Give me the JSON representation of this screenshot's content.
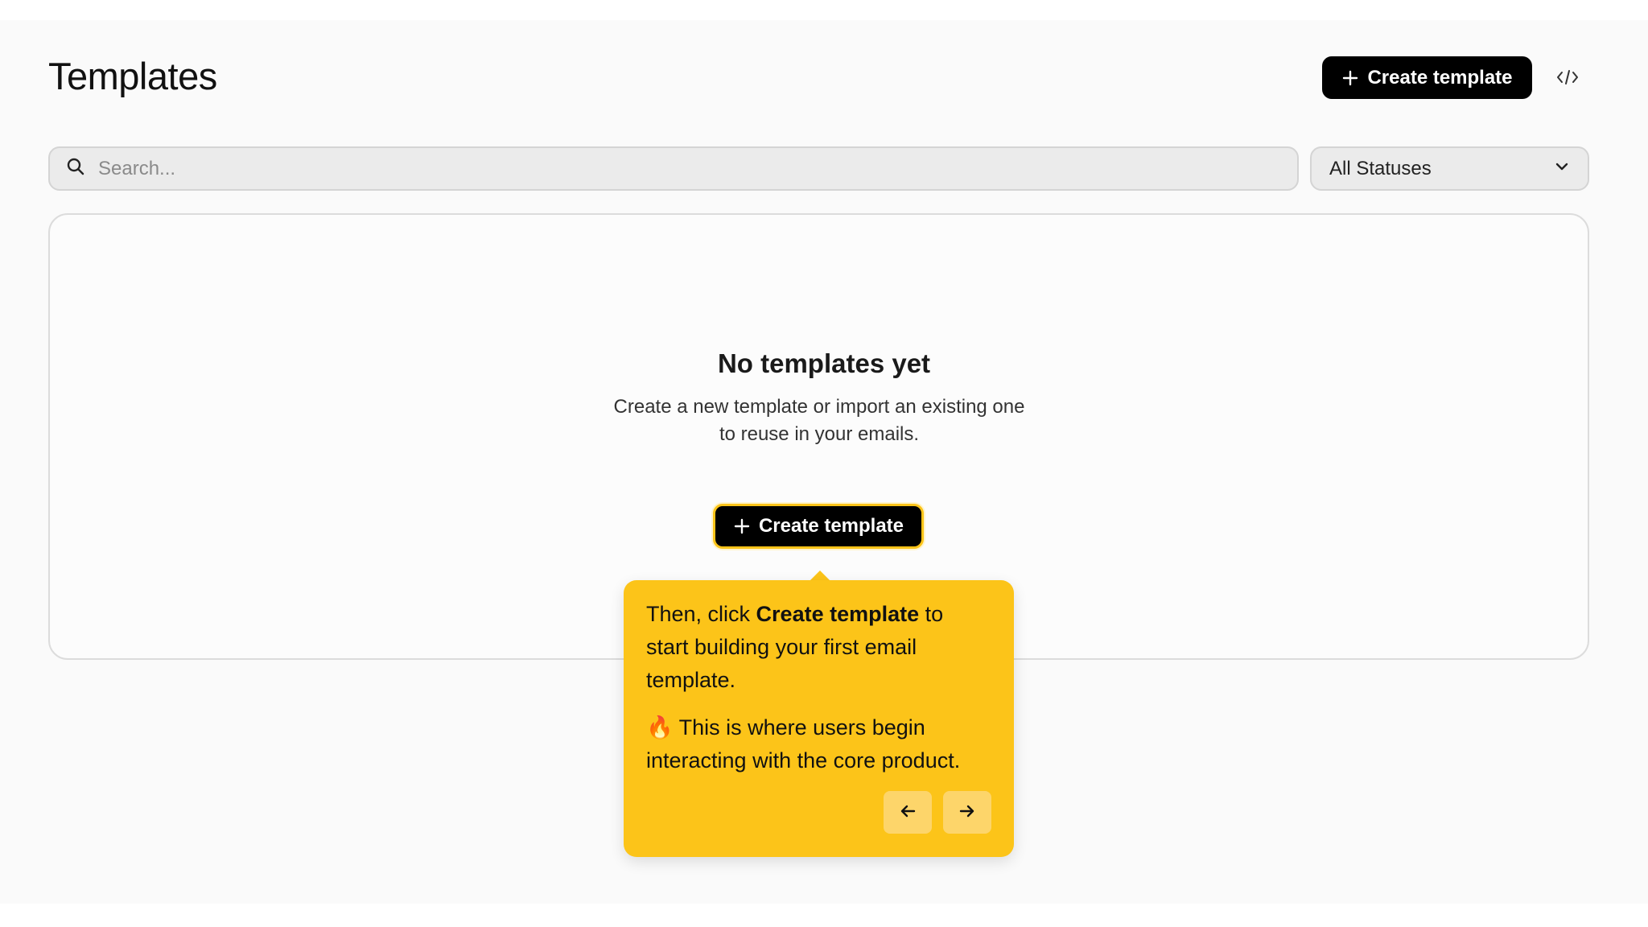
{
  "header": {
    "title": "Templates",
    "create_button_label": "Create template"
  },
  "filters": {
    "search_placeholder": "Search...",
    "status_selected": "All Statuses"
  },
  "empty_state": {
    "title": "No templates yet",
    "description": "Create a new template or import an existing one to reuse in your emails.",
    "button_label": "Create template"
  },
  "tooltip": {
    "line1_prefix": "Then, click ",
    "line1_bold": "Create template",
    "line1_suffix": " to start building your first email template.",
    "line2_emoji": "🔥",
    "line2_text": " This is where users begin interacting with the core product."
  },
  "icons": {
    "plus": "plus-icon",
    "code": "code-icon",
    "search": "search-icon",
    "chevron": "chevron-down-icon",
    "arrow_left": "arrow-left-icon",
    "arrow_right": "arrow-right-icon"
  },
  "colors": {
    "accent": "#fcc419",
    "primary_button": "#000000",
    "background": "#fafafa"
  }
}
